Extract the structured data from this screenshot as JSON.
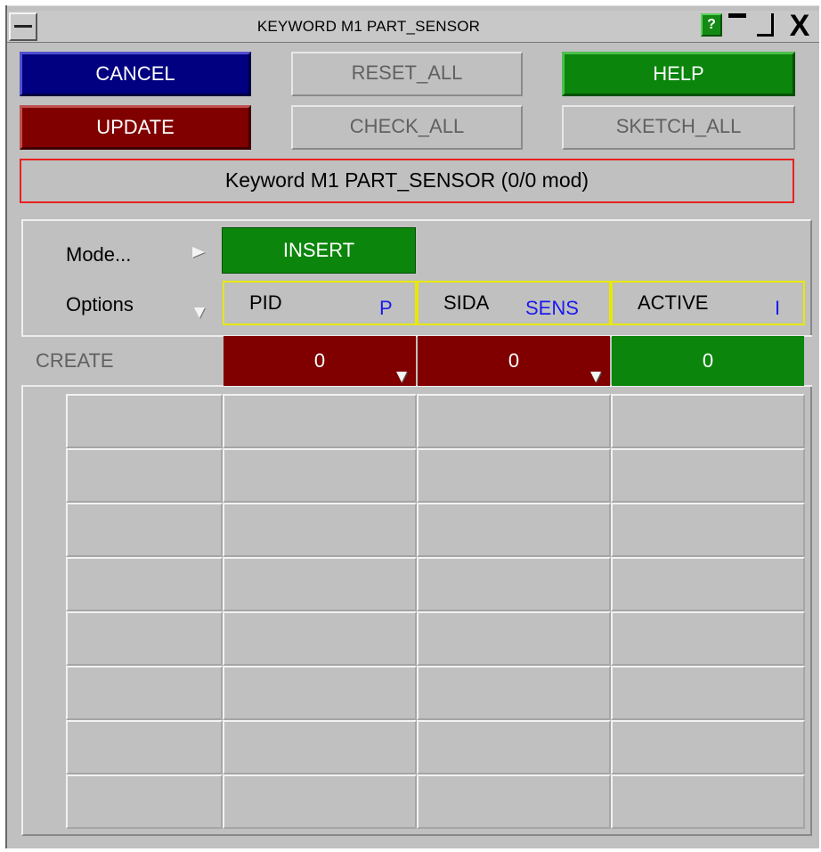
{
  "window": {
    "title": "KEYWORD M1 PART_SENSOR",
    "help_icon_label": "?",
    "close_glyph": "X",
    "icons": [
      "window-menu-icon",
      "help-icon",
      "minimize-icon",
      "maximize-icon",
      "close-icon"
    ]
  },
  "toolbar": {
    "cancel_label": "CANCEL",
    "reset_all_label": "RESET_ALL",
    "help_label": "HELP",
    "update_label": "UPDATE",
    "check_all_label": "CHECK_ALL",
    "sketch_all_label": "SKETCH_ALL"
  },
  "status": {
    "label": "Keyword M1 PART_SENSOR (0/0 mod)"
  },
  "controls": {
    "mode_label": "Mode...",
    "mode_value": "INSERT",
    "options_label": "Options"
  },
  "columns": [
    {
      "name": "PID",
      "unit": "P"
    },
    {
      "name": "SIDA",
      "unit": "SENS"
    },
    {
      "name": "ACTIVE",
      "unit": "I"
    }
  ],
  "create_row": {
    "label": "CREATE",
    "values": [
      "0",
      "0",
      "0"
    ]
  },
  "colors": {
    "panel": "#c0c0c0",
    "blue": "#000080",
    "red": "#800000",
    "green": "#0b850b",
    "header_border": "#e8e800",
    "status_border": "#e82020",
    "unit_text": "#1a1aee"
  },
  "grid": {
    "rows": 8,
    "columns": 4
  }
}
